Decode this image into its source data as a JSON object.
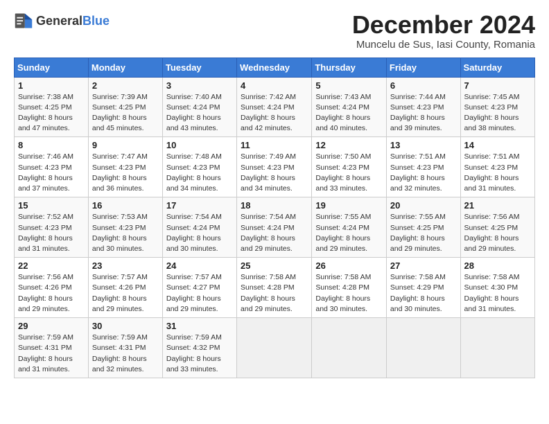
{
  "header": {
    "logo_general": "General",
    "logo_blue": "Blue",
    "month": "December 2024",
    "location": "Muncelu de Sus, Iasi County, Romania"
  },
  "weekdays": [
    "Sunday",
    "Monday",
    "Tuesday",
    "Wednesday",
    "Thursday",
    "Friday",
    "Saturday"
  ],
  "weeks": [
    [
      {
        "day": "1",
        "sunrise": "7:38 AM",
        "sunset": "4:25 PM",
        "daylight": "8 hours and 47 minutes."
      },
      {
        "day": "2",
        "sunrise": "7:39 AM",
        "sunset": "4:25 PM",
        "daylight": "8 hours and 45 minutes."
      },
      {
        "day": "3",
        "sunrise": "7:40 AM",
        "sunset": "4:24 PM",
        "daylight": "8 hours and 43 minutes."
      },
      {
        "day": "4",
        "sunrise": "7:42 AM",
        "sunset": "4:24 PM",
        "daylight": "8 hours and 42 minutes."
      },
      {
        "day": "5",
        "sunrise": "7:43 AM",
        "sunset": "4:24 PM",
        "daylight": "8 hours and 40 minutes."
      },
      {
        "day": "6",
        "sunrise": "7:44 AM",
        "sunset": "4:23 PM",
        "daylight": "8 hours and 39 minutes."
      },
      {
        "day": "7",
        "sunrise": "7:45 AM",
        "sunset": "4:23 PM",
        "daylight": "8 hours and 38 minutes."
      }
    ],
    [
      {
        "day": "8",
        "sunrise": "7:46 AM",
        "sunset": "4:23 PM",
        "daylight": "8 hours and 37 minutes."
      },
      {
        "day": "9",
        "sunrise": "7:47 AM",
        "sunset": "4:23 PM",
        "daylight": "8 hours and 36 minutes."
      },
      {
        "day": "10",
        "sunrise": "7:48 AM",
        "sunset": "4:23 PM",
        "daylight": "8 hours and 34 minutes."
      },
      {
        "day": "11",
        "sunrise": "7:49 AM",
        "sunset": "4:23 PM",
        "daylight": "8 hours and 34 minutes."
      },
      {
        "day": "12",
        "sunrise": "7:50 AM",
        "sunset": "4:23 PM",
        "daylight": "8 hours and 33 minutes."
      },
      {
        "day": "13",
        "sunrise": "7:51 AM",
        "sunset": "4:23 PM",
        "daylight": "8 hours and 32 minutes."
      },
      {
        "day": "14",
        "sunrise": "7:51 AM",
        "sunset": "4:23 PM",
        "daylight": "8 hours and 31 minutes."
      }
    ],
    [
      {
        "day": "15",
        "sunrise": "7:52 AM",
        "sunset": "4:23 PM",
        "daylight": "8 hours and 31 minutes."
      },
      {
        "day": "16",
        "sunrise": "7:53 AM",
        "sunset": "4:23 PM",
        "daylight": "8 hours and 30 minutes."
      },
      {
        "day": "17",
        "sunrise": "7:54 AM",
        "sunset": "4:24 PM",
        "daylight": "8 hours and 30 minutes."
      },
      {
        "day": "18",
        "sunrise": "7:54 AM",
        "sunset": "4:24 PM",
        "daylight": "8 hours and 29 minutes."
      },
      {
        "day": "19",
        "sunrise": "7:55 AM",
        "sunset": "4:24 PM",
        "daylight": "8 hours and 29 minutes."
      },
      {
        "day": "20",
        "sunrise": "7:55 AM",
        "sunset": "4:25 PM",
        "daylight": "8 hours and 29 minutes."
      },
      {
        "day": "21",
        "sunrise": "7:56 AM",
        "sunset": "4:25 PM",
        "daylight": "8 hours and 29 minutes."
      }
    ],
    [
      {
        "day": "22",
        "sunrise": "7:56 AM",
        "sunset": "4:26 PM",
        "daylight": "8 hours and 29 minutes."
      },
      {
        "day": "23",
        "sunrise": "7:57 AM",
        "sunset": "4:26 PM",
        "daylight": "8 hours and 29 minutes."
      },
      {
        "day": "24",
        "sunrise": "7:57 AM",
        "sunset": "4:27 PM",
        "daylight": "8 hours and 29 minutes."
      },
      {
        "day": "25",
        "sunrise": "7:58 AM",
        "sunset": "4:28 PM",
        "daylight": "8 hours and 29 minutes."
      },
      {
        "day": "26",
        "sunrise": "7:58 AM",
        "sunset": "4:28 PM",
        "daylight": "8 hours and 30 minutes."
      },
      {
        "day": "27",
        "sunrise": "7:58 AM",
        "sunset": "4:29 PM",
        "daylight": "8 hours and 30 minutes."
      },
      {
        "day": "28",
        "sunrise": "7:58 AM",
        "sunset": "4:30 PM",
        "daylight": "8 hours and 31 minutes."
      }
    ],
    [
      {
        "day": "29",
        "sunrise": "7:59 AM",
        "sunset": "4:31 PM",
        "daylight": "8 hours and 31 minutes."
      },
      {
        "day": "30",
        "sunrise": "7:59 AM",
        "sunset": "4:31 PM",
        "daylight": "8 hours and 32 minutes."
      },
      {
        "day": "31",
        "sunrise": "7:59 AM",
        "sunset": "4:32 PM",
        "daylight": "8 hours and 33 minutes."
      },
      null,
      null,
      null,
      null
    ]
  ],
  "labels": {
    "sunrise": "Sunrise:",
    "sunset": "Sunset:",
    "daylight": "Daylight:"
  }
}
